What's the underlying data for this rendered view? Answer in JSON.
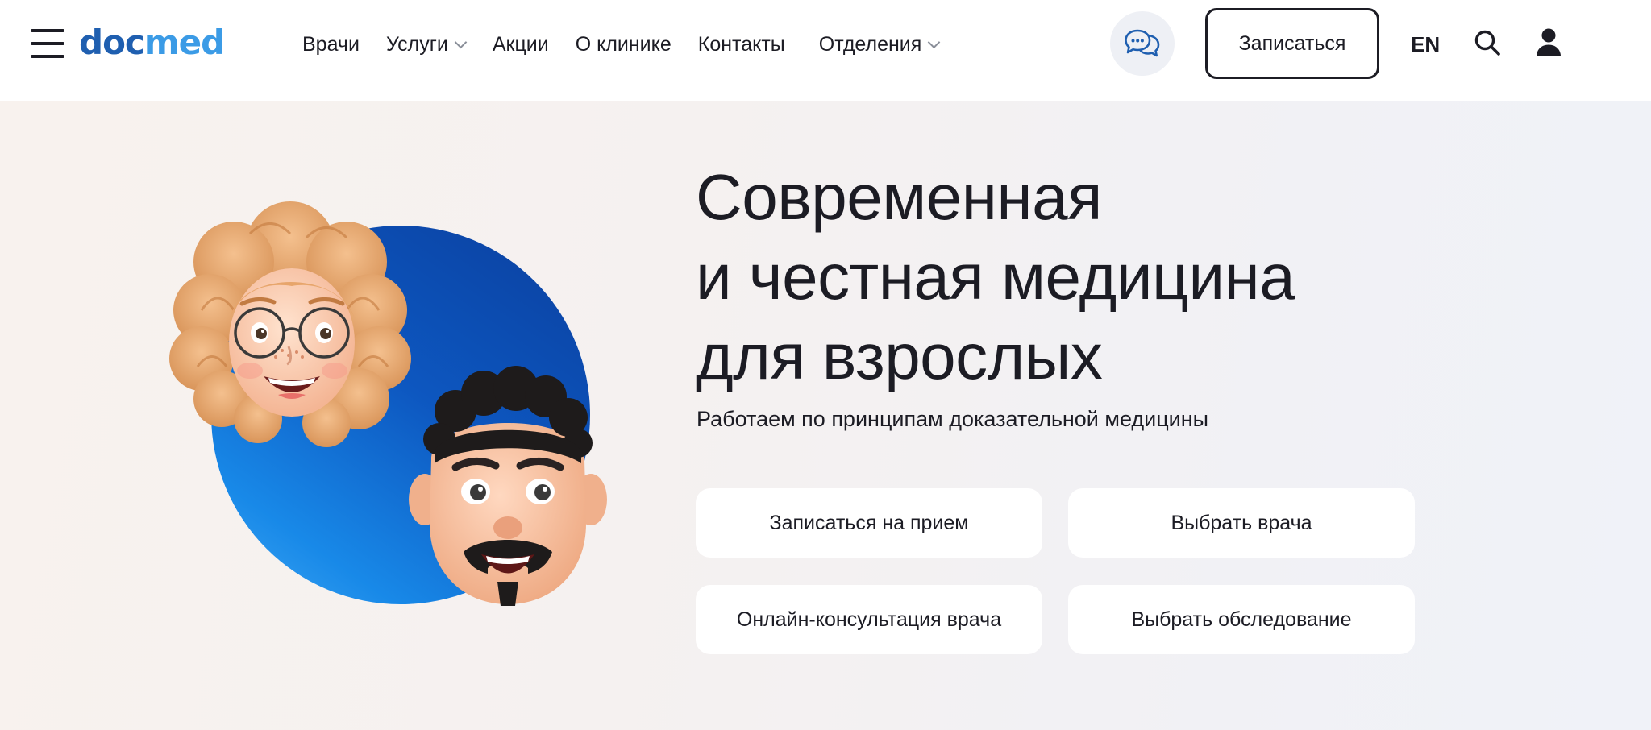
{
  "header": {
    "logo": {
      "part1": "doc",
      "part2": "med"
    },
    "nav": [
      {
        "label": "Врачи",
        "dropdown": false
      },
      {
        "label": "Услуги",
        "dropdown": true
      },
      {
        "label": "Акции",
        "dropdown": false
      },
      {
        "label": "О клинике",
        "dropdown": false
      },
      {
        "label": "Контакты",
        "dropdown": false
      },
      {
        "label": "Отделения",
        "dropdown": true
      }
    ],
    "signup_label": "Записаться",
    "language": "EN",
    "icons": [
      "menu-icon",
      "chat-icon",
      "search-icon",
      "user-icon",
      "chevron-down-icon"
    ]
  },
  "hero": {
    "headline": [
      "Современная",
      "и честная медицина",
      "для взрослых"
    ],
    "subtitle": "Работаем по принципам доказательной медицины",
    "actions": [
      "Записаться на прием",
      "Выбрать врача",
      "Онлайн-консультация врача",
      "Выбрать обследование"
    ]
  },
  "colors": {
    "brand_dark": "#1f5fb0",
    "brand_light": "#3b9be6",
    "text": "#1c1c24",
    "hero_circle": "#0d57c0"
  }
}
